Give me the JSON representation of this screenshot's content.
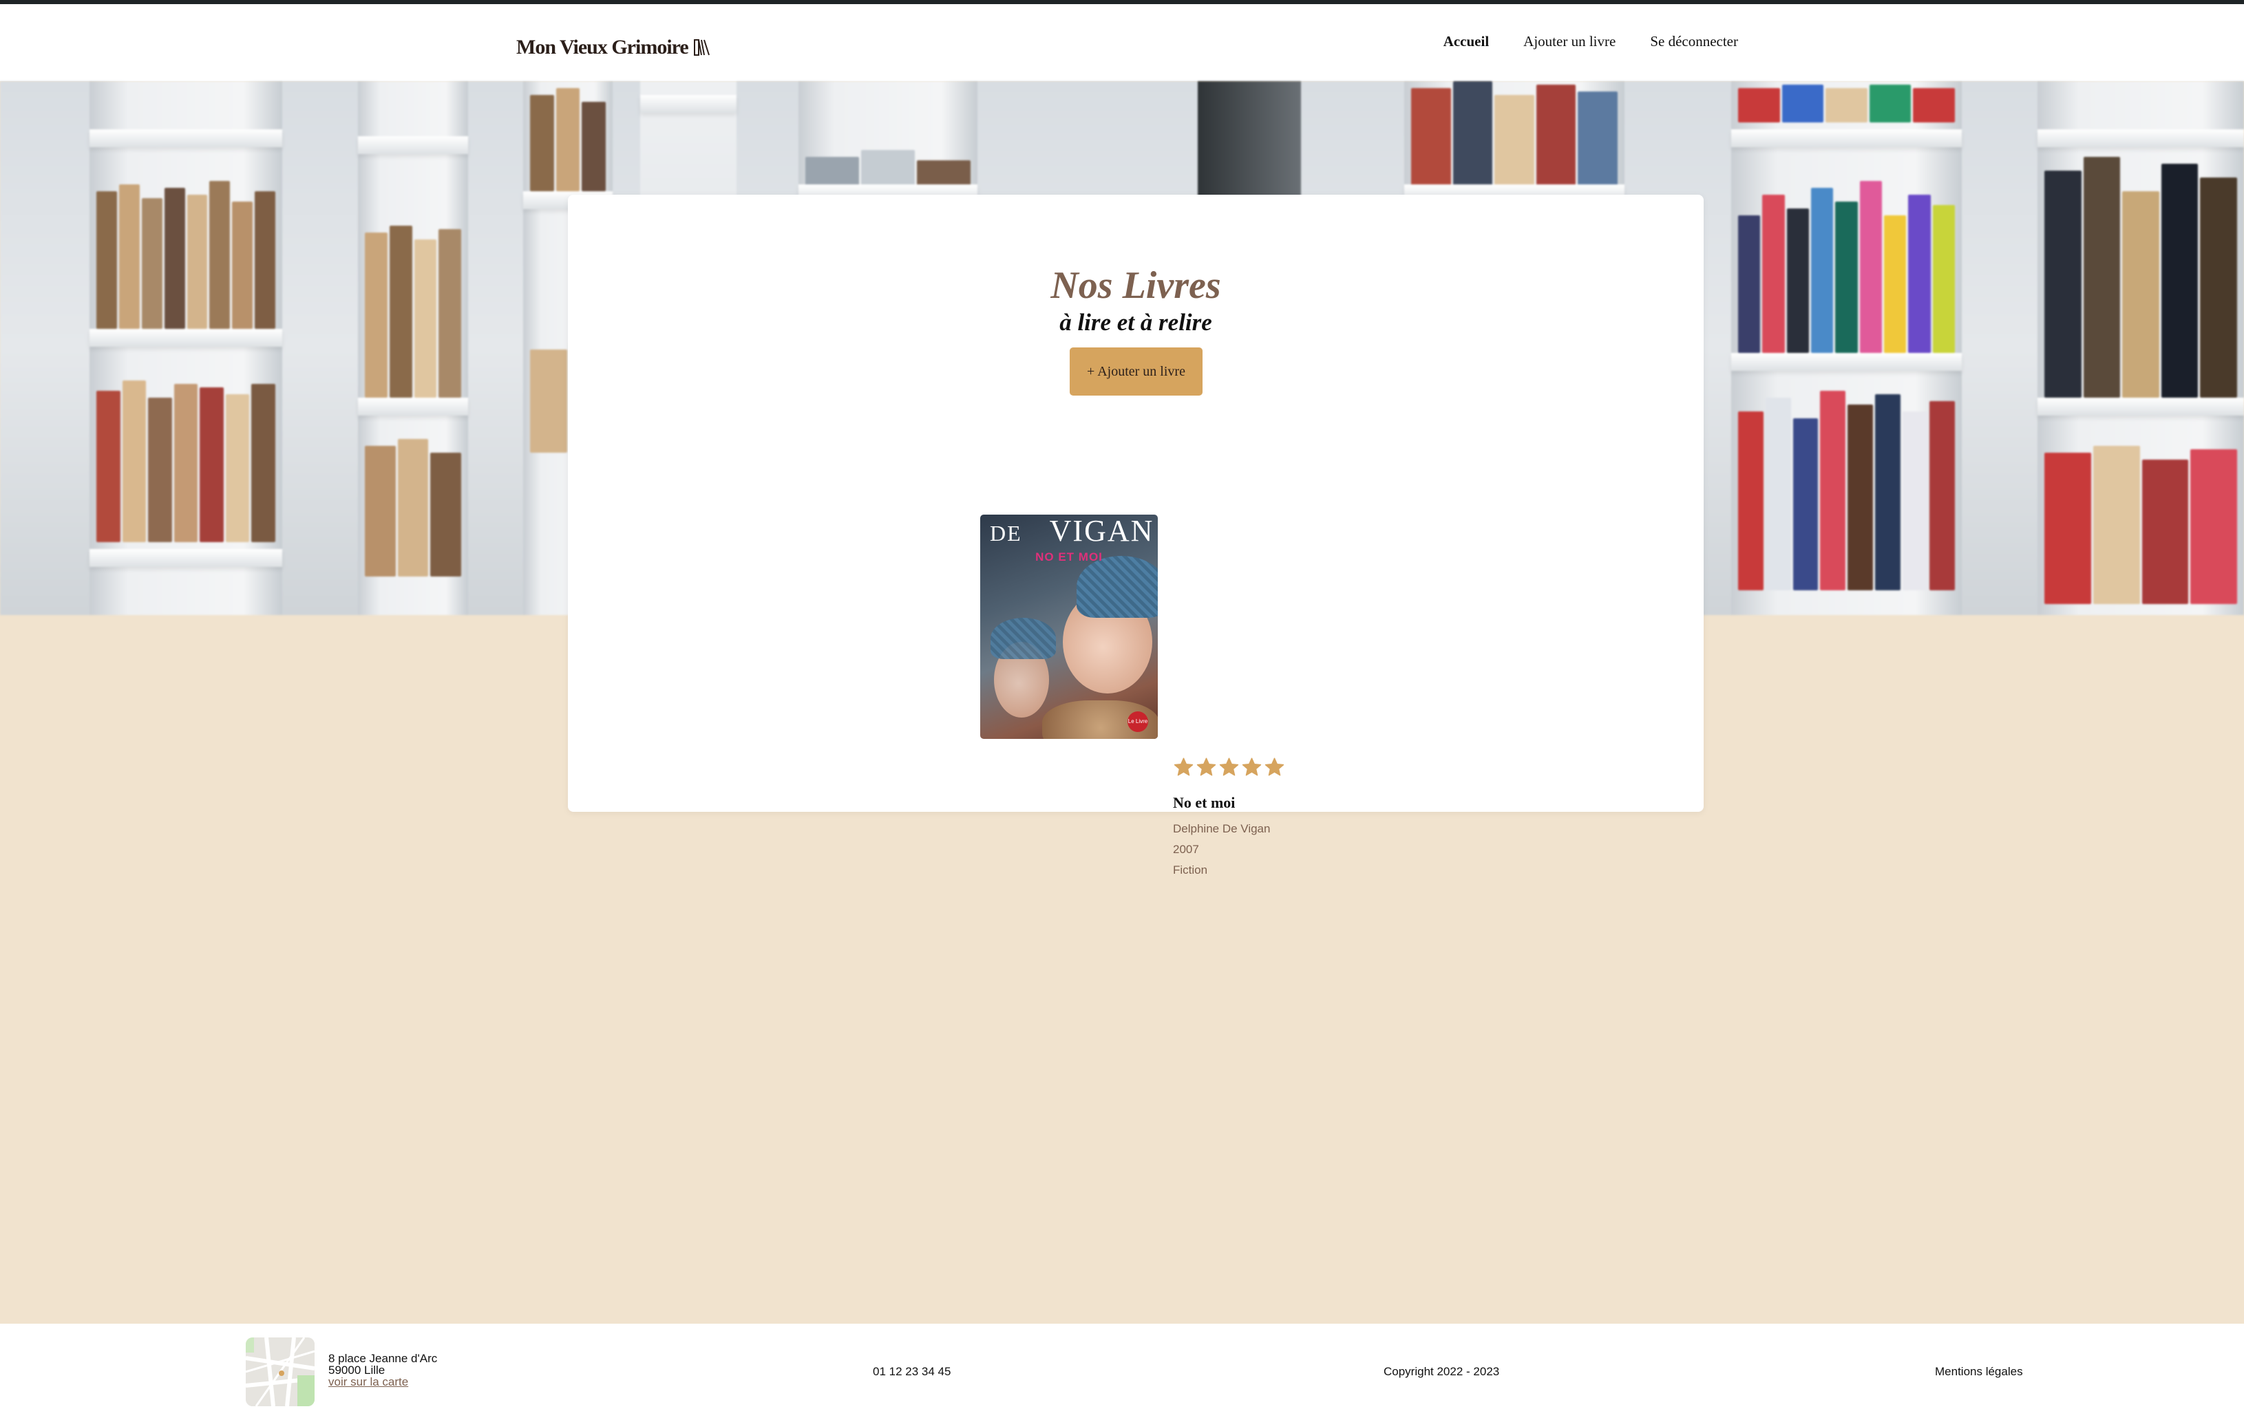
{
  "header": {
    "logo_text": "Mon Vieux Grimoire",
    "nav": [
      {
        "label": "Accueil",
        "active": true
      },
      {
        "label": "Ajouter un livre",
        "active": false
      },
      {
        "label": "Se déconnecter",
        "active": false
      }
    ]
  },
  "main": {
    "title": "Nos Livres",
    "subtitle": "à lire et à relire",
    "add_button_label": "+ Ajouter un livre",
    "books": [
      {
        "cover": {
          "author_small": "DE",
          "author_large": "VIGAN",
          "title": "NO ET MOI",
          "publisher_badge": "Le Livre"
        },
        "rating": 5,
        "rating_max": 5,
        "title": "No et moi",
        "author": "Delphine De Vigan",
        "year": "2007",
        "genre": "Fiction"
      }
    ]
  },
  "footer": {
    "address_line1": "8 place Jeanne d'Arc",
    "address_line2": "59000 Lille",
    "map_link": "voir sur la carte",
    "phone": "01 12 23 34 45",
    "copyright": "Copyright 2022 - 2023",
    "legal": "Mentions légales"
  },
  "colors": {
    "accent": "#d6a45e",
    "title_brown": "#7d6150",
    "page_background": "#f1e3ce",
    "topbar": "#1e2426"
  }
}
